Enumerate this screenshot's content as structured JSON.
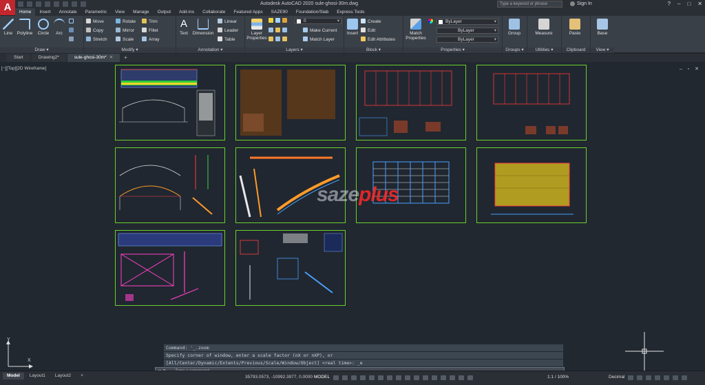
{
  "app": {
    "logo_letter": "A",
    "title": "Autodesk AutoCAD 2020   sule-ghosi-30m.dwg"
  },
  "search": {
    "placeholder": "Type a keyword or phrase"
  },
  "account": {
    "signin": "Sign In"
  },
  "ribbon_tabs": [
    "Home",
    "Insert",
    "Annotate",
    "Parametric",
    "View",
    "Manage",
    "Output",
    "Add-ins",
    "Collaborate",
    "Featured Apps",
    "SAZE90",
    "Foundation/Slab",
    "Express Tools"
  ],
  "panels": {
    "draw": {
      "title": "Draw ▾",
      "line": "Line",
      "polyline": "Polyline",
      "circle": "Circle",
      "arc": "Arc"
    },
    "modify": {
      "title": "Modify ▾",
      "move": "Move",
      "rotate": "Rotate",
      "trim": "Trim",
      "copy": "Copy",
      "mirror": "Mirror",
      "fillet": "Fillet",
      "stretch": "Stretch",
      "scale": "Scale",
      "array": "Array"
    },
    "annotation": {
      "title": "Annotation ▾",
      "text": "Text",
      "dimension": "Dimension",
      "linear": "Linear",
      "leader": "Leader",
      "table": "Table"
    },
    "layers": {
      "title": "Layers ▾",
      "layer_properties": "Layer\nProperties",
      "layer_value": "0",
      "make_current": "Make Current",
      "match_layer": "Match Layer"
    },
    "block": {
      "title": "Block ▾",
      "insert": "Insert",
      "create": "Create",
      "edit": "Edit",
      "edit_attributes": "Edit Attributes"
    },
    "properties": {
      "title": "Properties ▾",
      "match": "Match\nProperties",
      "color": "ByLayer",
      "linetype": "ByLayer",
      "lineweight": "ByLayer"
    },
    "groups": {
      "title": "Groups ▾",
      "group": "Group"
    },
    "utilities": {
      "title": "Utilities ▾",
      "measure": "Measure"
    },
    "clipboard": {
      "title": "Clipboard",
      "paste": "Paste"
    },
    "view": {
      "title": "View ▾",
      "base": "Base"
    }
  },
  "doc_tabs": [
    {
      "label": "Start"
    },
    {
      "label": "Drawing2*"
    },
    {
      "label": "sule-ghosi-30m*"
    }
  ],
  "viewport": {
    "label": "[−][Top][2D Wireframe]"
  },
  "watermark": {
    "part1": "saze",
    "part2": "plus"
  },
  "ucs": {
    "x": "X",
    "y": "Y"
  },
  "command": {
    "history": [
      "Command: '_.zoom",
      "Specify corner of window, enter a scale factor (nX or nXP), or",
      "[All/Center/Dynamic/Extents/Previous/Scale/Window/Object] <real time>: _e"
    ],
    "placeholder": "Type a command"
  },
  "layout_tabs": [
    "Model",
    "Layout1",
    "Layout2",
    "+"
  ],
  "status": {
    "coords": "35793.0573, -10992.3977, 0.0000",
    "mode": "MODEL",
    "scale": "1:1 / 100%",
    "units": "Decimal"
  },
  "colors": {
    "sheet_border": "#6cd12c",
    "background": "#212830",
    "ribbon": "#3a4048"
  }
}
